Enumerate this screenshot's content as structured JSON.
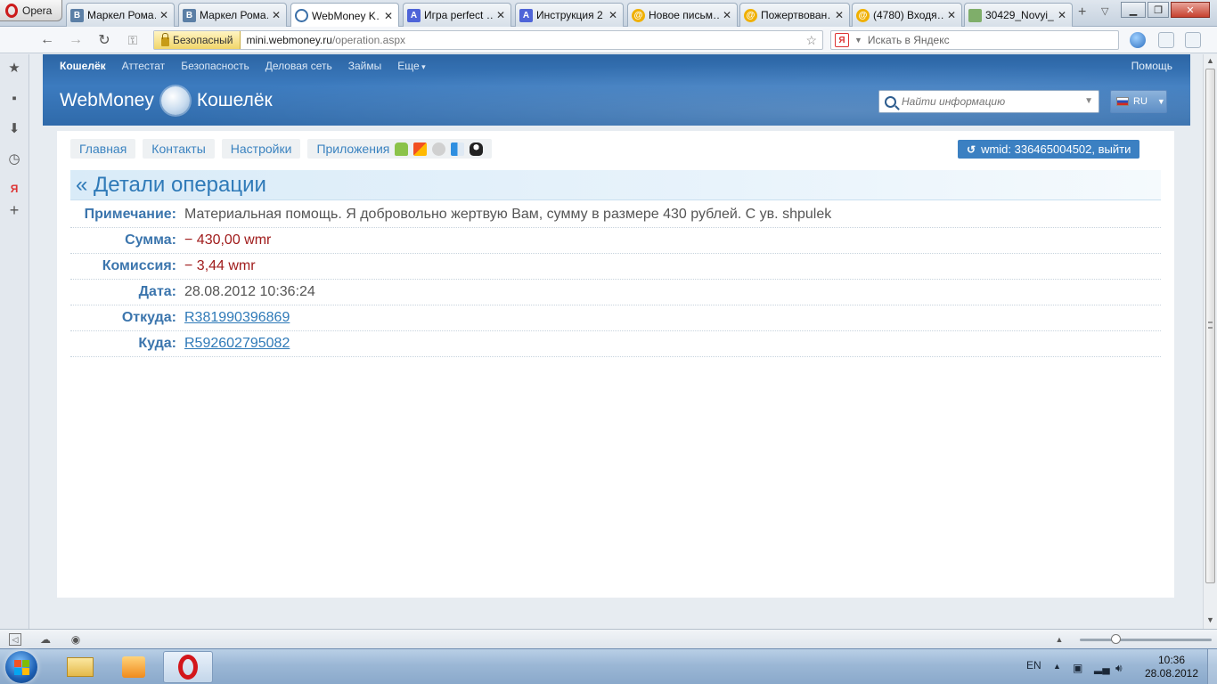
{
  "browser": {
    "menu_label": "Opera",
    "tabs": [
      {
        "title": "Маркел Рома…",
        "favicon": "vk-favicon"
      },
      {
        "title": "Маркел Рома…",
        "favicon": "vk-favicon"
      },
      {
        "title": "WebMoney K…",
        "favicon": "webmoney-favicon",
        "active": true
      },
      {
        "title": "Игра perfect …",
        "favicon": "a-favicon"
      },
      {
        "title": "Инструкция 2",
        "favicon": "a-favicon"
      },
      {
        "title": "Новое письм…",
        "favicon": "mail-favicon"
      },
      {
        "title": "Пожертвован…",
        "favicon": "mail-favicon"
      },
      {
        "title": "(4780) Входя…",
        "favicon": "mail-favicon"
      },
      {
        "title": "30429_Novyi_…",
        "favicon": "image-favicon"
      }
    ],
    "security_label": "Безопасный",
    "url_domain": "mini.webmoney.ru",
    "url_path": "/operation.aspx",
    "search_placeholder": "Искать в Яндекс",
    "search_engine_icon": "Я"
  },
  "site": {
    "top_nav": [
      "Кошелёк",
      "Аттестат",
      "Безопасность",
      "Деловая сеть",
      "Займы",
      "Еще"
    ],
    "help": "Помощь",
    "logo_text": "WebMoney",
    "logo_suffix": "Кошелёк",
    "search_placeholder": "Найти информацию",
    "lang": "RU",
    "sub_nav": [
      "Главная",
      "Контакты",
      "Настройки",
      "Приложения"
    ],
    "wmid_label": "wmid: 336465004502, выйти"
  },
  "operation": {
    "title": "« Детали операции",
    "rows": [
      {
        "label": "Примечание:",
        "value": "Материальная помощь. Я добровольно жертвую Вам, сумму в размере 430 рублей. С ув. shpulek",
        "kind": "text"
      },
      {
        "label": "Сумма:",
        "value": "− 430,00 wmr",
        "kind": "neg"
      },
      {
        "label": "Комиссия:",
        "value": "− 3,44 wmr",
        "kind": "neg"
      },
      {
        "label": "Дата:",
        "value": "28.08.2012 10:36:24",
        "kind": "text"
      },
      {
        "label": "Откуда:",
        "value": "R381990396869",
        "kind": "link"
      },
      {
        "label": "Куда:",
        "value": "R592602795082",
        "kind": "link"
      }
    ]
  },
  "taskbar": {
    "lang": "EN",
    "time": "10:36",
    "date": "28.08.2012"
  },
  "colors": {
    "brand_blue": "#2f6aaa",
    "link_blue": "#2f7ab8",
    "negative_red": "#a01c1c"
  }
}
